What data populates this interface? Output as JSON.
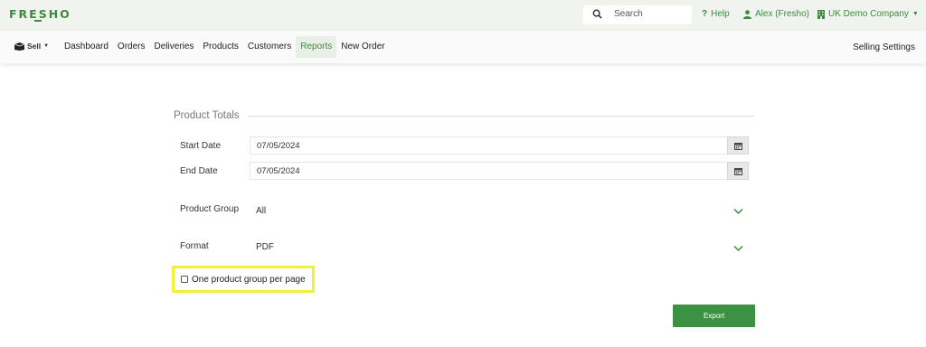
{
  "topbar": {
    "logo": "FRESHO",
    "search_placeholder": "Search",
    "help_label": "Help",
    "user_label": "Alex (Fresho)",
    "company_label": "UK Demo Company"
  },
  "nav": {
    "sell_label": "Sell",
    "items": [
      {
        "label": "Dashboard",
        "active": false
      },
      {
        "label": "Orders",
        "active": false
      },
      {
        "label": "Deliveries",
        "active": false
      },
      {
        "label": "Products",
        "active": false
      },
      {
        "label": "Customers",
        "active": false
      },
      {
        "label": "Reports",
        "active": true
      },
      {
        "label": "New Order",
        "active": false
      }
    ],
    "settings_label": "Selling Settings"
  },
  "form": {
    "title": "Product Totals",
    "start_date_label": "Start Date",
    "start_date_value": "07/05/2024",
    "end_date_label": "End Date",
    "end_date_value": "07/05/2024",
    "product_group_label": "Product Group",
    "product_group_value": "All",
    "format_label": "Format",
    "format_value": "PDF",
    "checkbox_label": "One product group per page",
    "checkbox_checked": false,
    "export_label": "Export"
  },
  "colors": {
    "brand_green": "#3d8b3d",
    "export_button": "#3d9142",
    "highlight_yellow": "#f5ef3b",
    "topbar_bg": "#f1f3ef"
  },
  "icons": {
    "search": "search-icon",
    "help": "question-icon",
    "user": "user-icon",
    "company": "building-icon",
    "sell": "box-icon",
    "calendar": "calendar-icon",
    "select": "chevron-down-icon"
  }
}
